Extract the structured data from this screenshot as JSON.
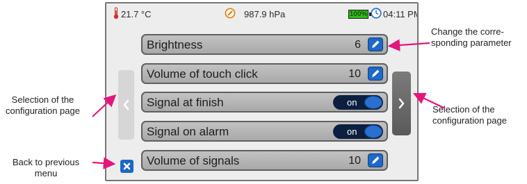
{
  "status_bar": {
    "temperature": "21.7 °C",
    "pressure": "987.9 hPa",
    "battery": "100%",
    "time": "04:11 PM"
  },
  "settings": [
    {
      "label": "Brightness",
      "value": "6",
      "control": "edit"
    },
    {
      "label": "Volume of touch click",
      "value": "10",
      "control": "edit"
    },
    {
      "label": "Signal at finish",
      "value": "on",
      "control": "toggle"
    },
    {
      "label": "Signal on alarm",
      "value": "on",
      "control": "toggle"
    },
    {
      "label": "Volume of signals",
      "value": "10",
      "control": "edit"
    }
  ],
  "callouts": {
    "change_parameter": [
      "Change the corre-",
      "sponding parameter"
    ],
    "selection_left": [
      "Selection of the",
      "configuration page"
    ],
    "selection_right": [
      "Selection of the",
      "configuration page"
    ],
    "back": [
      "Back to previous",
      "menu"
    ]
  },
  "colors": {
    "accent_blue": "#1d68c9",
    "toggle_dark": "#0c1f41",
    "arrow_magenta": "#e5157e",
    "battery_green": "#2fbf1c"
  }
}
